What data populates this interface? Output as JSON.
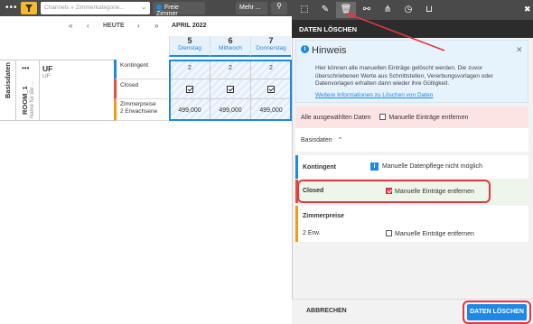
{
  "toolbar": {
    "search_placeholder": "Channels » Zimmerkategorie...",
    "free_rooms": "Freie Zimmer",
    "more": "Mehr ..."
  },
  "nav": {
    "first": "«",
    "prev": "‹",
    "today": "HEUTE",
    "next": "›",
    "last": "»",
    "month": "APRIL 2022"
  },
  "days": [
    {
      "num": "5",
      "name": "Dienstag"
    },
    {
      "num": "6",
      "name": "Mittwoch"
    },
    {
      "num": "7",
      "name": "Donnerstag"
    }
  ],
  "grid": {
    "group": "Basisdaten",
    "room": "ROOM_1",
    "room_sub": "Name für die ...",
    "uf_title": "UF",
    "uf_sub": "UF",
    "rows": [
      {
        "label": "Kontingent",
        "sub": "",
        "values": [
          "2",
          "2",
          "2"
        ],
        "color": "#1e88e5"
      },
      {
        "label": "Closed",
        "sub": "",
        "values": [
          "☑",
          "☑",
          "☑"
        ],
        "color": "#e74c3c"
      },
      {
        "label": "Zimmerpreise",
        "sub": "2 Erwachsene",
        "values": [
          "499,000",
          "499,000",
          "499,000"
        ],
        "color": "#f39c12"
      }
    ]
  },
  "panel": {
    "title": "DATEN LÖSCHEN",
    "hint_title": "Hinweis",
    "hint_text": "Hier können alle manuellen Einträge gelöscht werden. Die zuvor überschriebenen Werte aus Schnittstellen, Vererbungsvorlagen oder Datenvorlagen erhalten dann wieder ihre Gültigkeit.",
    "hint_link": "Weitere Informationen zu Löschen von Daten",
    "all_selected_label": "Alle ausgewählten Daten",
    "all_selected_check": "Manuelle Einträge entfernen",
    "basis_label": "Basisdaten",
    "kontingent_label": "Kontingent",
    "kontingent_value": "Manuelle Datenpflege nicht möglich",
    "closed_label": "Closed",
    "closed_check": "Manuelle Einträge entfernen",
    "zimmerpreise_label": "Zimmerpreise",
    "erw_label": "2 Erw.",
    "erw_check": "Manuelle Einträge entfernen",
    "cancel": "ABBRECHEN",
    "submit": "DATEN LÖSCHEN"
  }
}
